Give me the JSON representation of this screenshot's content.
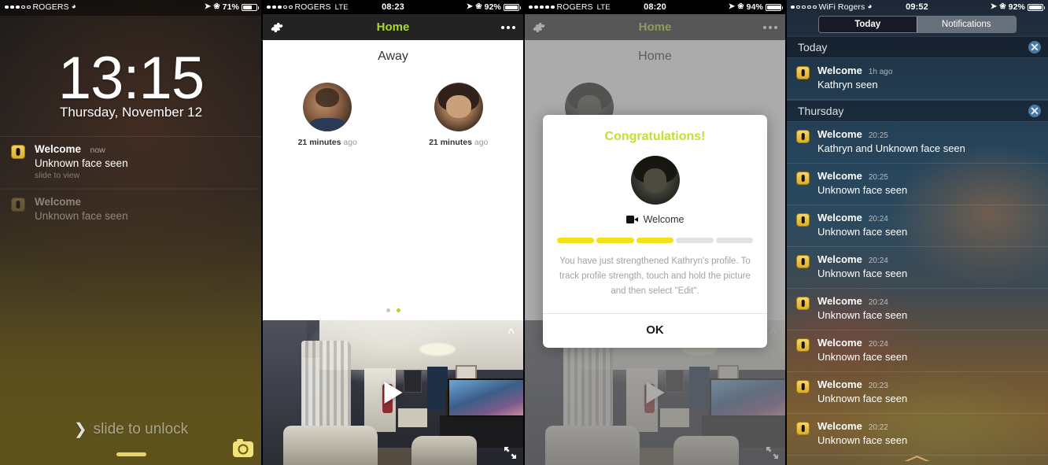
{
  "panel1": {
    "status": {
      "carrier": "ROGERS",
      "dots_filled": 3,
      "dots_total": 5,
      "time": "",
      "battery": "71%"
    },
    "clock": "13:15",
    "date": "Thursday, November 12",
    "notifications": [
      {
        "title": "Welcome",
        "time": "now",
        "body": "Unknown face seen",
        "hint": "slide to view",
        "faded": false
      },
      {
        "title": "Welcome",
        "time": "",
        "body": "Unknown face seen",
        "hint": "",
        "faded": true
      }
    ],
    "slide_to_unlock": "slide to unlock",
    "camera_icon": "camera-icon",
    "chevron_icon": "chevron-right-icon"
  },
  "panel2": {
    "status": {
      "carrier": "ROGERS",
      "network": "LTE",
      "dots_filled": 3,
      "dots_total": 5,
      "time": "08:23",
      "battery": "92%"
    },
    "nav": {
      "title": "Home",
      "gear_icon": "gear-icon",
      "more_icon": "more-dots-icon",
      "title_color": "#a9d92c"
    },
    "section_title": "Away",
    "faces": [
      {
        "caption_bold": "21 minutes",
        "caption_rest": " ago",
        "avatar": "male-face"
      },
      {
        "caption_bold": "21 minutes",
        "caption_rest": " ago",
        "avatar": "female-face"
      }
    ],
    "pager": {
      "count": 2,
      "active_index": 1
    },
    "video": {
      "play_icon": "play-icon",
      "chevron_icon": "chevron-up-icon",
      "expand_icon": "expand-icon"
    }
  },
  "panel3": {
    "status": {
      "carrier": "ROGERS",
      "network": "LTE",
      "dots_filled": 5,
      "dots_total": 5,
      "time": "08:20",
      "battery": "94%"
    },
    "nav": {
      "title": "Home",
      "gear_icon": "gear-icon",
      "more_icon": "more-dots-icon",
      "title_color": "#a9d92c"
    },
    "section_title": "Home",
    "modal": {
      "heading": "Congratulations!",
      "heading_color": "#c8dd2e",
      "name": "Welcome",
      "name_icon": "video-camera-icon",
      "strength": {
        "segments": 5,
        "filled": 3,
        "fill_color": "#f3e017",
        "empty_color": "#e2e2e2"
      },
      "message": "You have just strengthened Kathryn's profile. To track profile strength, touch and hold the picture and then select \"Edit\".",
      "ok_label": "OK"
    },
    "video": {
      "play_icon": "play-icon",
      "chevron_icon": "chevron-up-icon",
      "expand_icon": "expand-icon"
    }
  },
  "panel4": {
    "status": {
      "carrier": "WiFi Rogers",
      "dots_filled": 1,
      "dots_total": 5,
      "time": "09:52",
      "battery": "92%"
    },
    "tabs": [
      {
        "label": "Today",
        "selected": true
      },
      {
        "label": "Notifications",
        "selected": false
      }
    ],
    "sections": [
      {
        "header": "Today",
        "clear_icon": "clear-x-icon",
        "items": [
          {
            "title": "Welcome",
            "time": "1h ago",
            "body": "Kathryn seen"
          }
        ]
      },
      {
        "header": "Thursday",
        "clear_icon": "clear-x-icon",
        "items": [
          {
            "title": "Welcome",
            "time": "20:25",
            "body": "Kathryn and Unknown face seen"
          },
          {
            "title": "Welcome",
            "time": "20:25",
            "body": "Unknown face seen"
          },
          {
            "title": "Welcome",
            "time": "20:24",
            "body": "Unknown face seen"
          },
          {
            "title": "Welcome",
            "time": "20:24",
            "body": "Unknown face seen"
          },
          {
            "title": "Welcome",
            "time": "20:24",
            "body": "Unknown face seen"
          },
          {
            "title": "Welcome",
            "time": "20:24",
            "body": "Unknown face seen"
          },
          {
            "title": "Welcome",
            "time": "20:23",
            "body": "Unknown face seen"
          },
          {
            "title": "Welcome",
            "time": "20:22",
            "body": "Unknown face seen"
          }
        ]
      }
    ],
    "grabber_icon": "grabber-handle-icon"
  }
}
